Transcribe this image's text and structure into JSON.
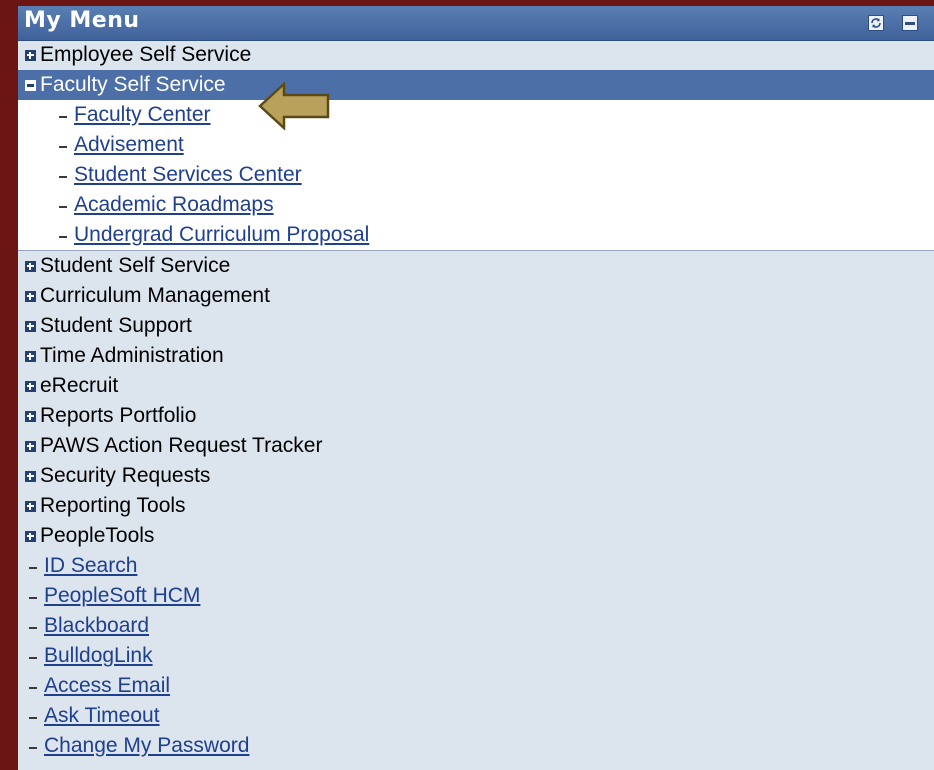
{
  "header": {
    "title": "My Menu",
    "refresh_icon": "refresh-icon",
    "collapse_icon": "minimize-icon"
  },
  "menu": {
    "folders_before": [
      {
        "label": "Employee Self Service",
        "state": "collapsed"
      }
    ],
    "expanded_folder": {
      "label": "Faculty Self Service",
      "state": "expanded",
      "children": [
        "Faculty Center",
        "Advisement",
        "Student Services Center",
        "Academic Roadmaps",
        "Undergrad Curriculum Proposal"
      ]
    },
    "folders_after": [
      "Student Self Service",
      "Curriculum Management",
      "Student Support",
      "Time Administration",
      "eRecruit",
      "Reports Portfolio",
      "PAWS Action Request Tracker",
      "Security Requests",
      "Reporting Tools",
      "PeopleTools"
    ],
    "links": [
      "ID Search",
      "PeopleSoft HCM",
      "Blackboard",
      "BulldogLink",
      "Access Email",
      "Ask Timeout",
      "Change My Password"
    ]
  },
  "colors": {
    "page_background": "#6b1515",
    "panel_background": "#dce4ee",
    "header_background": "#3f629a",
    "selected_row": "#4d6fa8",
    "link": "#1f3f8f",
    "pointer_arrow": "#b8a15a"
  }
}
